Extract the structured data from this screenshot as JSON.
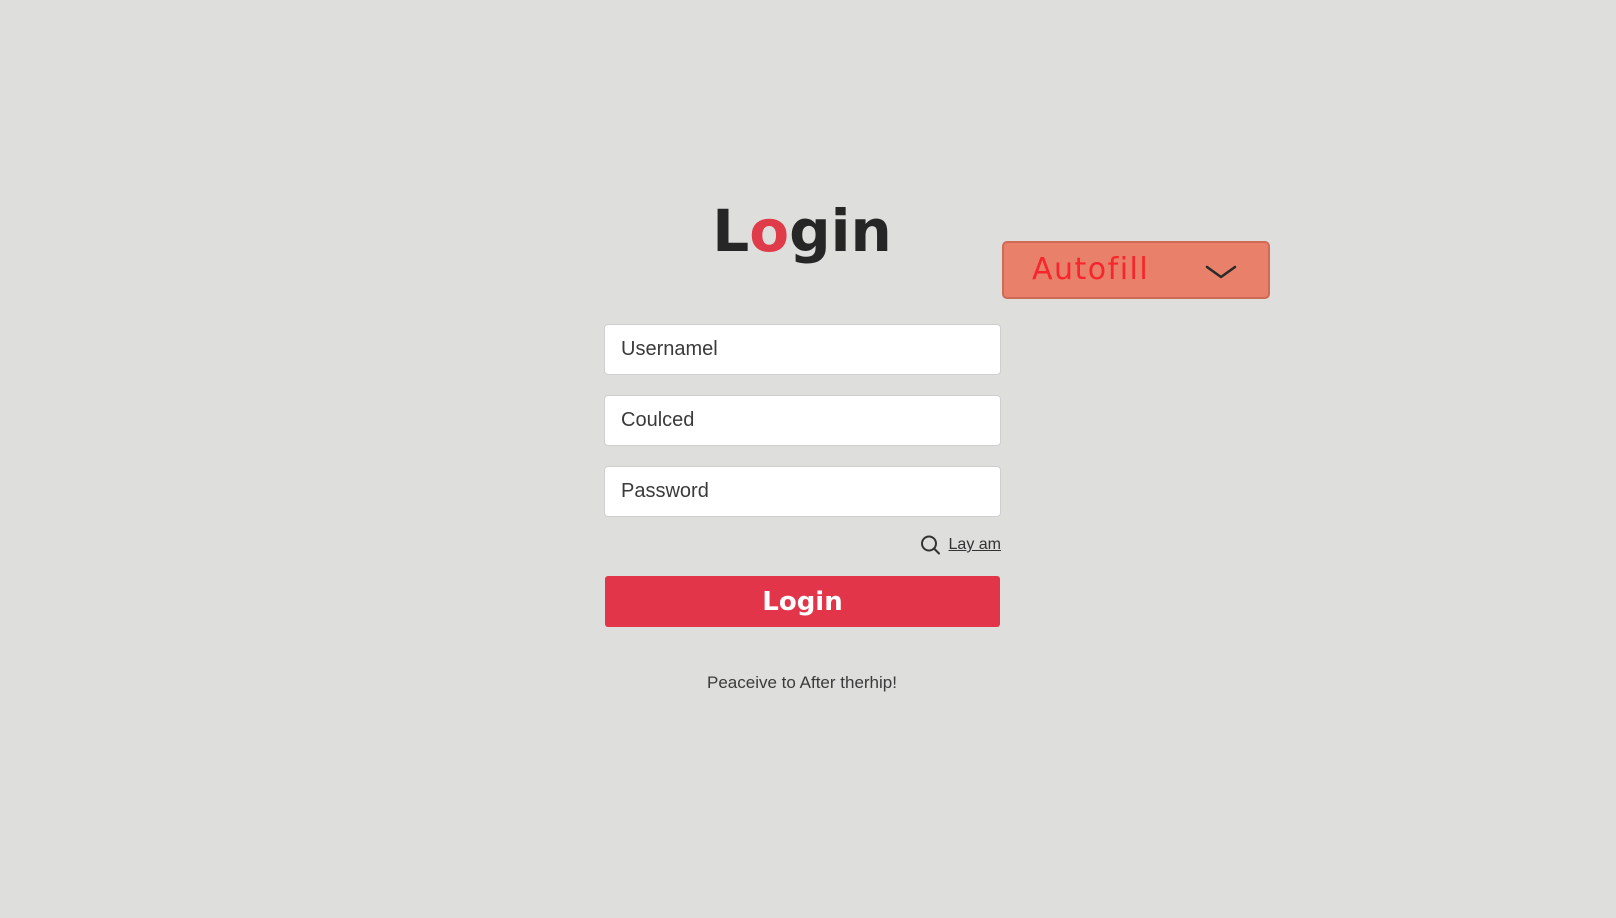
{
  "login_form": {
    "title_prefix": "L",
    "title_accent": "o",
    "title_suffix": "gin",
    "fields": [
      {
        "placeholder": "Usernamel"
      },
      {
        "placeholder": "Coulced"
      },
      {
        "placeholder": "Password"
      }
    ],
    "helper_link": {
      "label": "Lay am",
      "icon": "search-icon"
    },
    "submit_label": "Login",
    "footer_text": "Peaceive to After therhip!"
  },
  "autofill": {
    "label": "Autofill",
    "icon": "chevron-down-icon"
  },
  "colors": {
    "accent": "#e03b48",
    "button": "#e2354a",
    "autofill_bg": "#e8806a",
    "autofill_text": "#f7262c",
    "background": "#dedfdc"
  }
}
